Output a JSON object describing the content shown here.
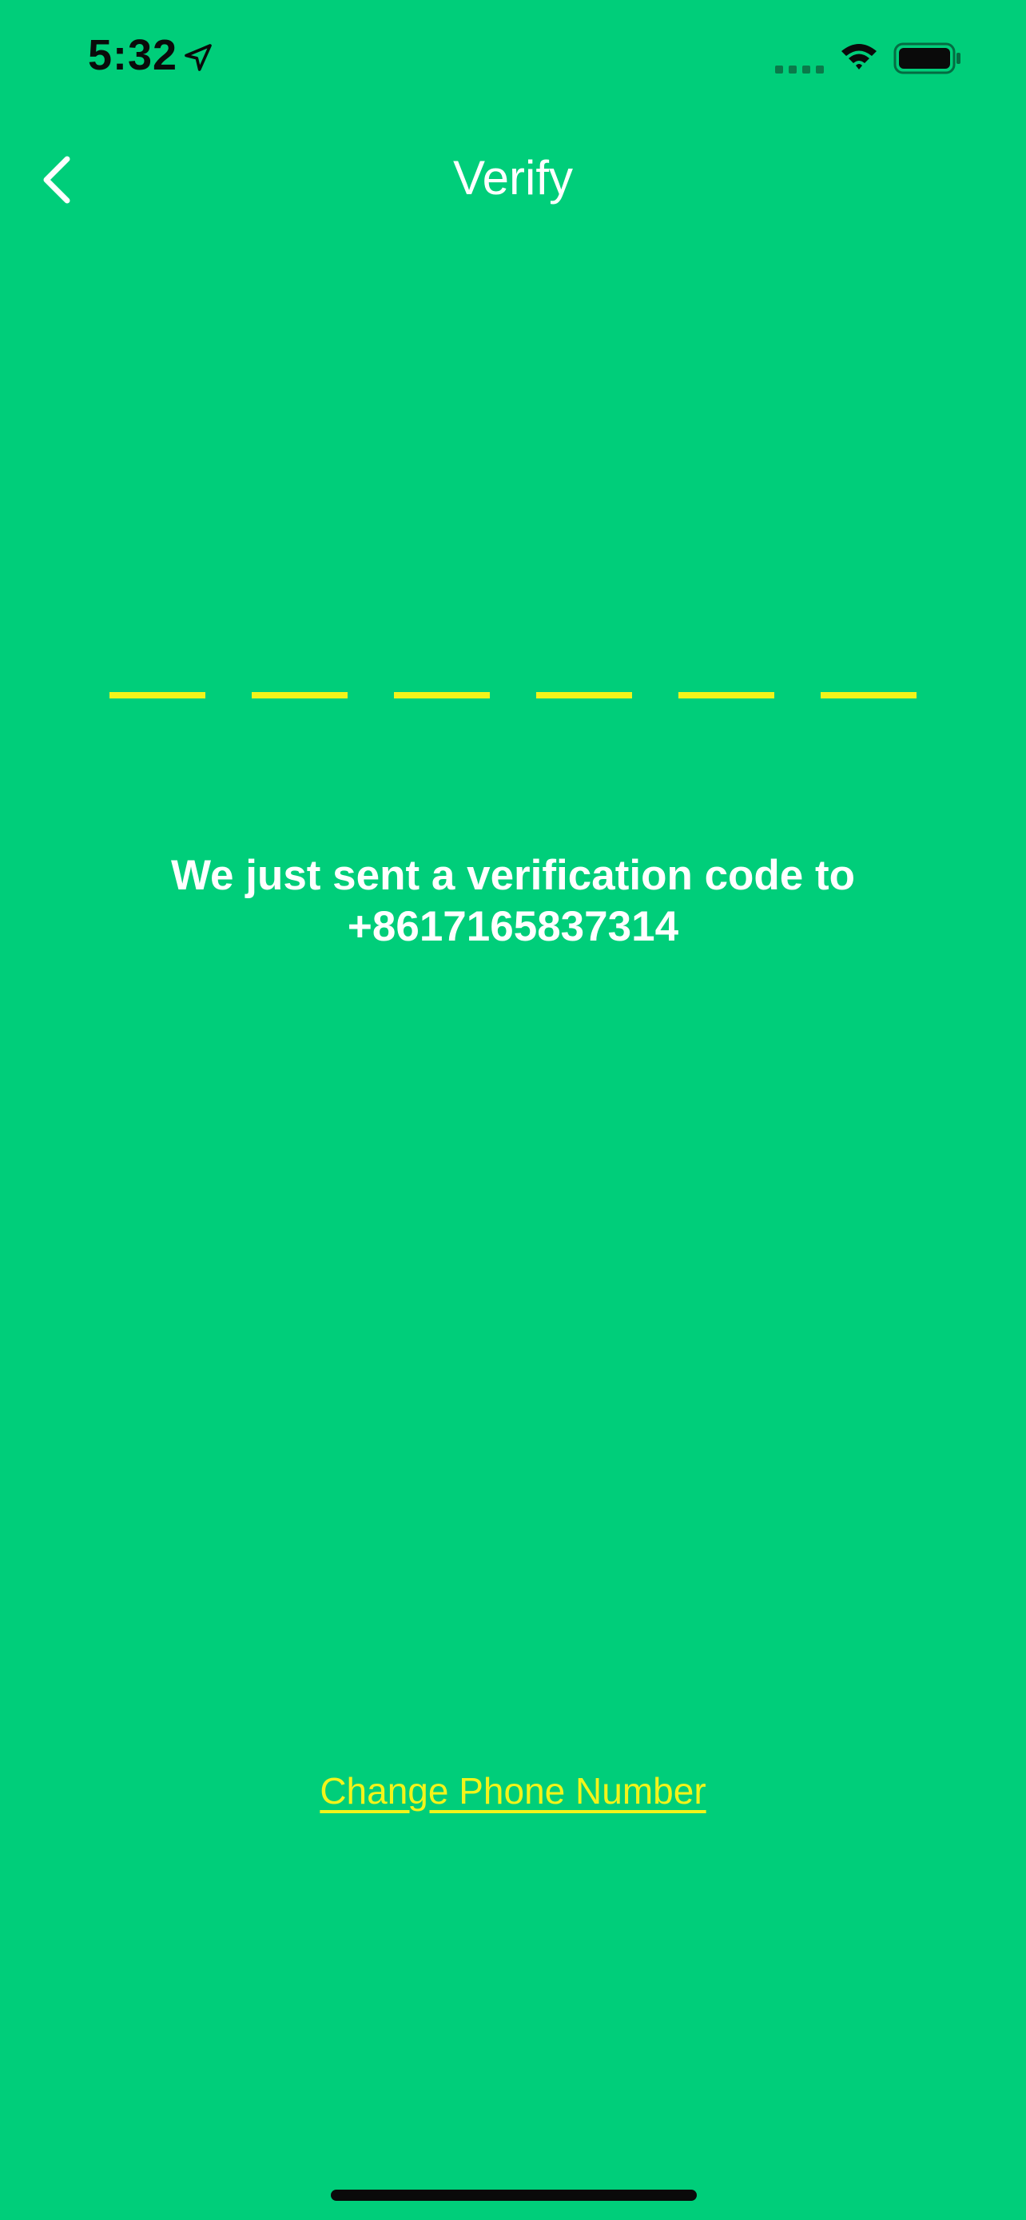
{
  "status_bar": {
    "time": "5:32",
    "icons": [
      "location-arrow-icon",
      "cellular-signal-icon",
      "wifi-icon",
      "battery-icon"
    ]
  },
  "nav": {
    "title": "Verify",
    "back_icon": "chevron-left-icon"
  },
  "code_input": {
    "length": 6,
    "values": [
      "",
      "",
      "",
      "",
      "",
      ""
    ]
  },
  "message": {
    "line1": "We just sent a verification code to",
    "phone": "+8617165837314"
  },
  "change_phone": {
    "label": "Change Phone Number"
  },
  "colors": {
    "background": "#00CE7A",
    "accent": "#F2F41A",
    "text": "#FFFFFF"
  }
}
